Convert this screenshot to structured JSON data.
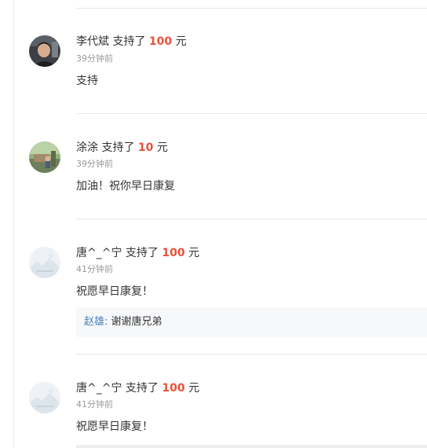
{
  "entries": [
    {
      "name": "李代斌",
      "action": "支持了",
      "amount": "100",
      "unit": "元",
      "time": "39分钟前",
      "message": "支持",
      "avatar": "user-photo"
    },
    {
      "name": "涂涂",
      "action": "支持了",
      "amount": "10",
      "unit": "元",
      "time": "39分钟前",
      "message": "加油！祝你早日康复",
      "avatar": "user-photo"
    },
    {
      "name": "唐^_^宁",
      "action": "支持了",
      "amount": "100",
      "unit": "元",
      "time": "41分钟前",
      "message": "祝愿早日康复！",
      "avatar": "default-avatar",
      "reply": {
        "name": "赵雄",
        "separator": ":",
        "text": "谢谢唐兄弟"
      }
    },
    {
      "name": "唐^_^宁",
      "action": "支持了",
      "amount": "100",
      "unit": "元",
      "time": "41分钟前",
      "message": "祝愿早日康复！",
      "avatar": "default-avatar"
    }
  ],
  "colors": {
    "amount": "#e8523a",
    "reply_name": "#4a7fb8",
    "time": "#999999",
    "divider": "#e8e8e8"
  }
}
